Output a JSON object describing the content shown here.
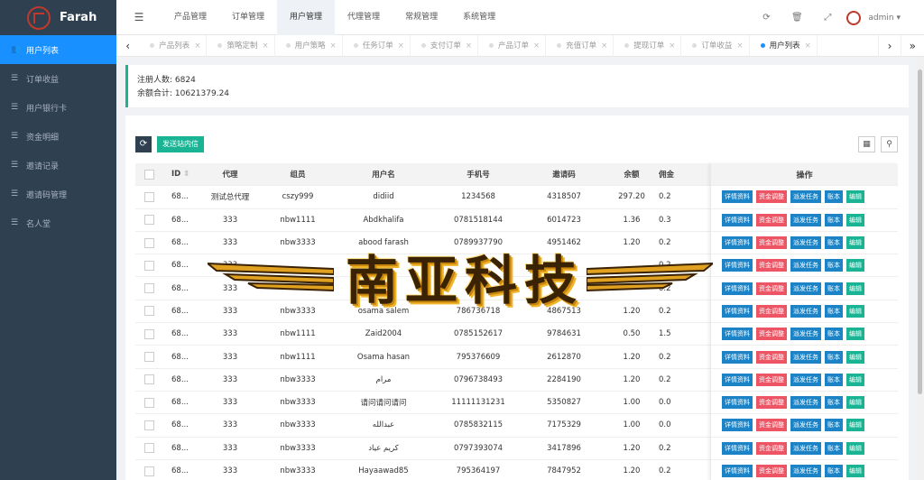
{
  "app": {
    "name": "Farah"
  },
  "sidebar": {
    "items": [
      {
        "label": "用户列表",
        "icon": "users-icon"
      },
      {
        "label": "订单收益",
        "icon": "list-icon"
      },
      {
        "label": "用户银行卡",
        "icon": "list-icon"
      },
      {
        "label": "资金明细",
        "icon": "list-icon"
      },
      {
        "label": "邀请记录",
        "icon": "list-icon"
      },
      {
        "label": "邀请码管理",
        "icon": "list-icon"
      },
      {
        "label": "名人堂",
        "icon": "list-icon"
      }
    ]
  },
  "topnav": {
    "items": [
      "产品管理",
      "订单管理",
      "用户管理",
      "代理管理",
      "常规管理",
      "系统管理"
    ],
    "user": "admin"
  },
  "tabs": [
    "产品列表",
    "策略定制",
    "用户策略",
    "任务订单",
    "支付订单",
    "产品订单",
    "充值订单",
    "提现订单",
    "订单收益",
    "用户列表"
  ],
  "summary": {
    "registered": "注册人数: 6824",
    "balance": "余额合计: 10621379.24"
  },
  "toolbar": {
    "send": "发送站内信"
  },
  "table": {
    "headers": [
      "ID",
      "代理",
      "组员",
      "用户名",
      "手机号",
      "邀请码",
      "余额",
      "佣金"
    ],
    "ops_header": "操作",
    "op_buttons": [
      "详情资料",
      "资金调整",
      "派发任务",
      "账本",
      "编辑"
    ],
    "rows": [
      [
        "68...",
        "测试总代理",
        "cszy999",
        "didiid",
        "1234568",
        "4318507",
        "297.20",
        "0.2"
      ],
      [
        "68...",
        "333",
        "nbw1111",
        "Abdkhalifa",
        "0781518144",
        "6014723",
        "1.36",
        "0.3"
      ],
      [
        "68...",
        "333",
        "nbw3333",
        "abood farash",
        "0789937790",
        "4951462",
        "1.20",
        "0.2"
      ],
      [
        "68...",
        "333",
        "",
        "",
        "",
        "",
        "",
        "0.2"
      ],
      [
        "68...",
        "333",
        "",
        "",
        "",
        "",
        "",
        "0.2"
      ],
      [
        "68...",
        "333",
        "nbw3333",
        "osama salem",
        "786736718",
        "4867513",
        "1.20",
        "0.2"
      ],
      [
        "68...",
        "333",
        "nbw1111",
        "Zaid2004",
        "0785152617",
        "9784631",
        "0.50",
        "1.5"
      ],
      [
        "68...",
        "333",
        "nbw1111",
        "Osama hasan",
        "795376609",
        "2612870",
        "1.20",
        "0.2"
      ],
      [
        "68...",
        "333",
        "nbw3333",
        "مرام",
        "0796738493",
        "2284190",
        "1.20",
        "0.2"
      ],
      [
        "68...",
        "333",
        "nbw3333",
        "请问请问请问",
        "11111131231",
        "5350827",
        "1.00",
        "0.0"
      ],
      [
        "68...",
        "333",
        "nbw3333",
        "عبدالله",
        "0785832115",
        "7175329",
        "1.00",
        "0.0"
      ],
      [
        "68...",
        "333",
        "nbw3333",
        "كريم عياد",
        "0797393074",
        "3417896",
        "1.20",
        "0.2"
      ],
      [
        "68...",
        "333",
        "nbw3333",
        "Hayaawad85",
        "795364197",
        "7847952",
        "1.20",
        "0.2"
      ]
    ]
  },
  "watermark": "南亚科技"
}
